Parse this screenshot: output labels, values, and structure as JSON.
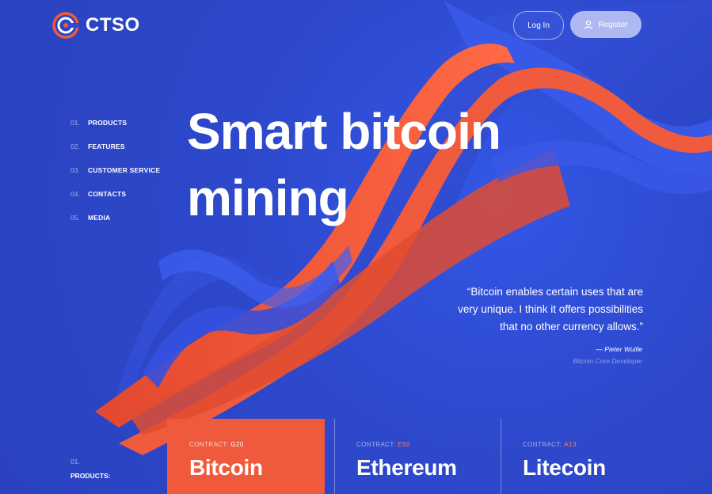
{
  "brand": {
    "name": "CTSO"
  },
  "header": {
    "login_label": "Log In",
    "register_label": "Register"
  },
  "nav": {
    "items": [
      {
        "num": "01.",
        "label": "PRODUCTS"
      },
      {
        "num": "02.",
        "label": "FEATURES"
      },
      {
        "num": "03.",
        "label": "CUSTOMER SERVICE"
      },
      {
        "num": "04.",
        "label": "CONTACTS"
      },
      {
        "num": "05.",
        "label": "MEDIA"
      }
    ]
  },
  "hero": {
    "title_line1": "Smart bitcoin",
    "title_line2": "mining"
  },
  "quote": {
    "line1": "“Bitcoin enables certain uses that are",
    "line2": "very unique. I think it offers possibilities",
    "line3": "that no other currency allows.”",
    "author": "— Pieter Wuille",
    "role": "Bitcoin Core Developer"
  },
  "products": {
    "num": "01.",
    "label": "PRODUCTS:",
    "cards": [
      {
        "contract_label": "CONTRACT:",
        "code": "G20",
        "name": "Bitcoin"
      },
      {
        "contract_label": "CONTRACT:",
        "code": "E50",
        "name": "Ethereum"
      },
      {
        "contract_label": "CONTRACT:",
        "code": "A13",
        "name": "Litecoin"
      }
    ]
  },
  "colors": {
    "background": "#2f4bd0",
    "accent": "#f05a3c",
    "register_button": "#aeb9f2"
  },
  "icons": {
    "logo": "ctso-logo-icon",
    "register": "user-icon"
  }
}
